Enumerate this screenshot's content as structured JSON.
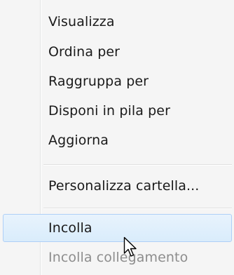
{
  "context_menu": {
    "items": [
      {
        "label": "Visualizza",
        "state": "normal"
      },
      {
        "label": "Ordina per",
        "state": "normal"
      },
      {
        "label": "Raggruppa per",
        "state": "normal"
      },
      {
        "label": "Disponi in pila per",
        "state": "normal"
      },
      {
        "label": "Aggiorna",
        "state": "normal"
      },
      {
        "label": "Personalizza cartella...",
        "state": "normal"
      },
      {
        "label": "Incolla",
        "state": "hover"
      },
      {
        "label": "Incolla collegamento",
        "state": "disabled"
      }
    ]
  },
  "cursor": {
    "icon": "arrow-pointer-icon"
  },
  "colors": {
    "menu_background": "#f5f5f5",
    "hover_background": "#dcedfc",
    "hover_border": "#aecff7",
    "disabled_text": "#8d8d8d"
  }
}
